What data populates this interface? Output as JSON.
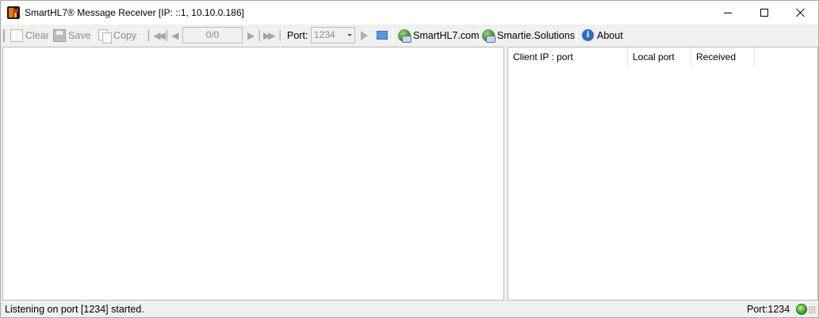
{
  "window": {
    "title": "SmartHL7® Message Receiver [IP: ::1, 10.10.0.186]"
  },
  "toolbar": {
    "clear_label": "Clear",
    "save_label": "Save",
    "copy_label": "Copy",
    "message_counter": "0/0",
    "port_label": "Port:",
    "port_value": "1234",
    "smarthl7_link": "SmartHL7.com",
    "smartie_link": "Smartie.Solutions",
    "about_label": "About"
  },
  "connections_table": {
    "columns": [
      "Client IP : port",
      "Local port",
      "Received"
    ],
    "rows": []
  },
  "statusbar": {
    "message": "Listening on port [1234] started.",
    "port": "Port:1234",
    "status_color": "#3fa52a"
  }
}
